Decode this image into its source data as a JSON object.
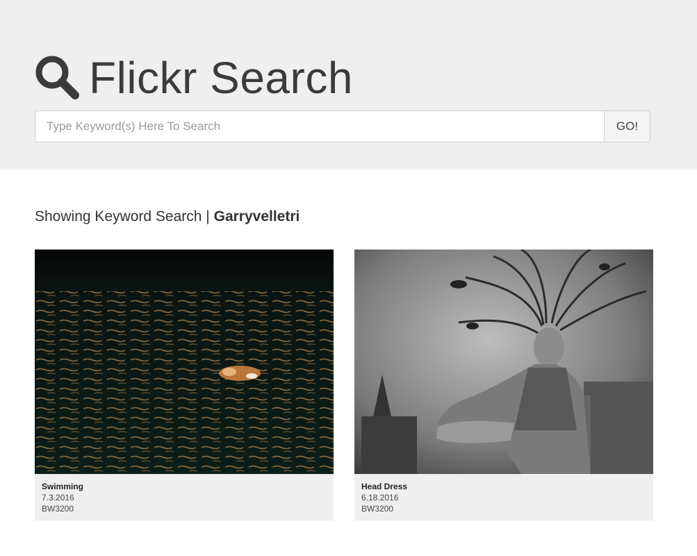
{
  "header": {
    "title": "Flickr Search",
    "icon": "search-icon"
  },
  "search": {
    "placeholder": "Type Keyword(s) Here To Search",
    "value": "",
    "button_label": "GO!"
  },
  "results": {
    "label": "Showing Keyword Search |",
    "keyword": "Garryvelletri",
    "items": [
      {
        "title": "Swimming",
        "date": "7.3.2016",
        "owner": "BW3200"
      },
      {
        "title": "Head Dress",
        "date": "6.18.2016",
        "owner": "BW3200"
      }
    ]
  },
  "colors": {
    "hero_background": "#efefef",
    "card_background": "#efefef",
    "text": "#333333"
  }
}
